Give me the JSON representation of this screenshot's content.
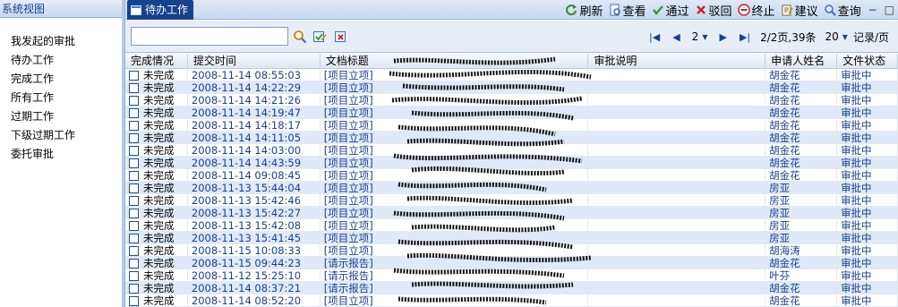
{
  "left": {
    "header": "系统视图",
    "items": [
      "我发起的审批",
      "待办工作",
      "完成工作",
      "所有工作",
      "过期工作",
      "下级过期工作",
      "委托审批"
    ]
  },
  "tab": {
    "label": "待办工作"
  },
  "actions": [
    {
      "label": "刷新",
      "icon": "refresh-icon",
      "color": "#2e8b2e"
    },
    {
      "label": "查看",
      "icon": "view-icon",
      "color": "#3a6fb5"
    },
    {
      "label": "通过",
      "icon": "check-icon",
      "color": "#2e9b2e"
    },
    {
      "label": "驳回",
      "icon": "x-icon",
      "color": "#d02020"
    },
    {
      "label": "终止",
      "icon": "stop-icon",
      "color": "#d02020"
    },
    {
      "label": "建议",
      "icon": "note-icon",
      "color": "#b07a10"
    },
    {
      "label": "查询",
      "icon": "search-icon",
      "color": "#3a6fb5"
    }
  ],
  "search": {
    "value": ""
  },
  "pager": {
    "page": "2",
    "info": "2/2页,39条",
    "per_page": "20",
    "per_page_unit": "记录/页"
  },
  "columns": [
    "完成情况",
    "提交时间",
    "文档标题",
    "审批说明",
    "申请人姓名",
    "文件状态"
  ],
  "rows": [
    {
      "status": "未完成",
      "time": "2008-11-14 08:55:03",
      "title": "[项目立项]",
      "applicant": "胡金花",
      "state": "审批中"
    },
    {
      "status": "未完成",
      "time": "2008-11-14 14:22:29",
      "title": "[项目立项]",
      "applicant": "胡金花",
      "state": "审批中"
    },
    {
      "status": "未完成",
      "time": "2008-11-14 14:21:26",
      "title": "[项目立项]",
      "applicant": "胡金花",
      "state": "审批中"
    },
    {
      "status": "未完成",
      "time": "2008-11-14 14:19:47",
      "title": "[项目立项]",
      "applicant": "胡金花",
      "state": "审批中"
    },
    {
      "status": "未完成",
      "time": "2008-11-14 14:18:17",
      "title": "[项目立项]",
      "applicant": "胡金花",
      "state": "审批中"
    },
    {
      "status": "未完成",
      "time": "2008-11-14 14:11:05",
      "title": "[项目立项]",
      "applicant": "胡金花",
      "state": "审批中"
    },
    {
      "status": "未完成",
      "time": "2008-11-14 14:03:00",
      "title": "[项目立项]",
      "applicant": "胡金花",
      "state": "审批中"
    },
    {
      "status": "未完成",
      "time": "2008-11-14 14:43:59",
      "title": "[项目立项]",
      "applicant": "胡金花",
      "state": "审批中"
    },
    {
      "status": "未完成",
      "time": "2008-11-14 09:08:45",
      "title": "[项目立项]",
      "applicant": "胡金花",
      "state": "审批中"
    },
    {
      "status": "未完成",
      "time": "2008-11-13 15:44:04",
      "title": "[项目立项]",
      "applicant": "房亚",
      "state": "审批中"
    },
    {
      "status": "未完成",
      "time": "2008-11-13 15:42:46",
      "title": "[项目立项]",
      "applicant": "房亚",
      "state": "审批中"
    },
    {
      "status": "未完成",
      "time": "2008-11-13 15:42:27",
      "title": "[项目立项]",
      "applicant": "房亚",
      "state": "审批中"
    },
    {
      "status": "未完成",
      "time": "2008-11-13 15:42:08",
      "title": "[项目立项]",
      "applicant": "房亚",
      "state": "审批中"
    },
    {
      "status": "未完成",
      "time": "2008-11-13 15:41:45",
      "title": "[项目立项]",
      "applicant": "房亚",
      "state": "审批中"
    },
    {
      "status": "未完成",
      "time": "2008-11-15 10:08:33",
      "title": "[项目立项]",
      "applicant": "胡海涛",
      "state": "审批中"
    },
    {
      "status": "未完成",
      "time": "2008-11-15 09:44:23",
      "title": "[请示报告]",
      "applicant": "胡金花",
      "state": "审批中"
    },
    {
      "status": "未完成",
      "time": "2008-11-12 15:25:10",
      "title": "[请示报告]",
      "applicant": "叶芬",
      "state": "审批中"
    },
    {
      "status": "未完成",
      "time": "2008-11-14 08:37:21",
      "title": "[请示报告]",
      "applicant": "胡金花",
      "state": "审批中"
    },
    {
      "status": "未完成",
      "time": "2008-11-14 08:52:20",
      "title": "[项目立项]",
      "applicant": "胡金花",
      "state": "审批中"
    }
  ],
  "colors": {
    "accent": "#15428b",
    "row_alt": "#dfe9f7",
    "header_bg": "#c9d9f0"
  }
}
